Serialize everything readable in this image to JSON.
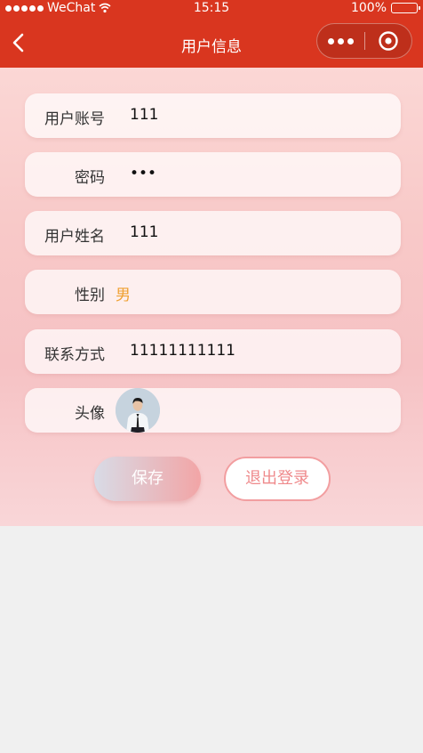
{
  "status_bar": {
    "carrier": "WeChat",
    "time": "15:15",
    "battery": "100%"
  },
  "nav": {
    "title": "用户信息"
  },
  "form": {
    "account": {
      "label": "用户账号",
      "value": "111"
    },
    "password": {
      "label": "密码",
      "value": "•••"
    },
    "name": {
      "label": "用户姓名",
      "value": "111"
    },
    "gender": {
      "label": "性别",
      "value": "男"
    },
    "phone": {
      "label": "联系方式",
      "value": "11111111111"
    },
    "avatar": {
      "label": "头像"
    }
  },
  "buttons": {
    "save": "保存",
    "logout": "退出登录"
  },
  "colors": {
    "brand": "#d9361f",
    "gender_text": "#f0a030",
    "logout_text": "#ef8a8c"
  }
}
